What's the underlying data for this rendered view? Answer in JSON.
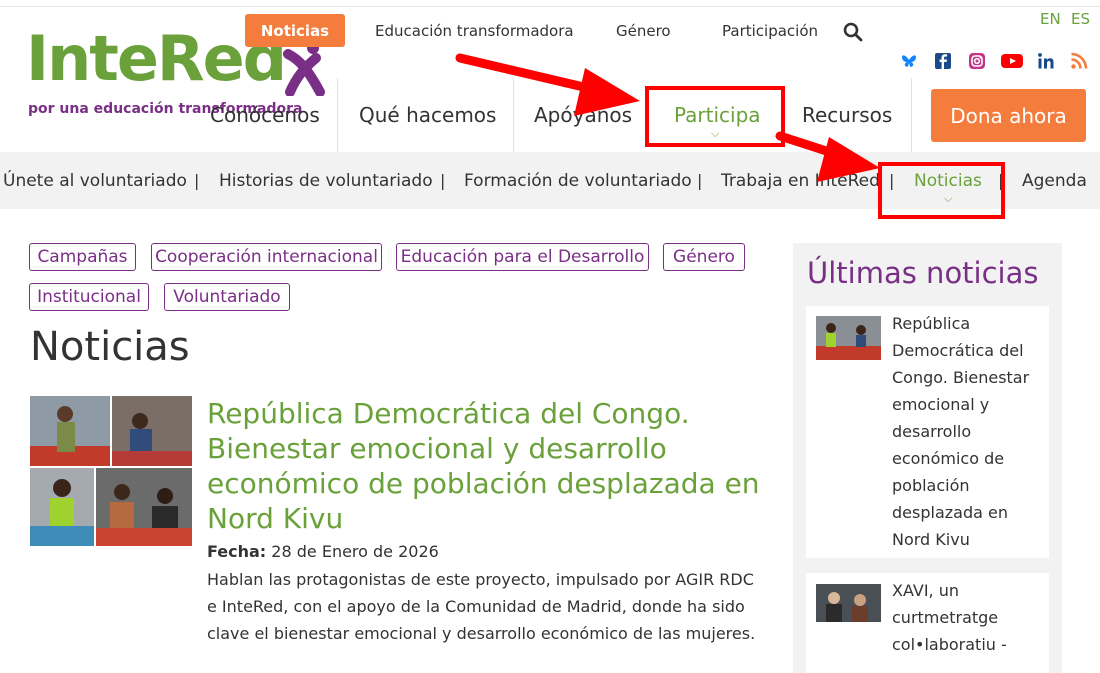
{
  "top_nav": {
    "active": "Noticias",
    "items": [
      "Educación transformadora",
      "Género",
      "Participación"
    ]
  },
  "lang": {
    "en": "EN",
    "es": "ES"
  },
  "logo": {
    "text": "InteRed",
    "tagline": "por una educación transformadora"
  },
  "main_nav": {
    "items": [
      "Conócenos",
      "Qué hacemos",
      "Apóyanos",
      "Participa",
      "Recursos"
    ],
    "donate": "Dona ahora"
  },
  "sub_nav": {
    "items": [
      "Únete al voluntariado",
      "Historias de voluntariado",
      "Formación de voluntariado",
      "Trabaja en InteRed",
      "Noticias",
      "Agenda"
    ],
    "separator": "|"
  },
  "tags": [
    "Campañas",
    "Cooperación internacional",
    "Educación para el Desarrollo",
    "Género",
    "Institucional",
    "Voluntariado"
  ],
  "page_title": "Noticias",
  "article": {
    "title": "República Democrática del Congo. Bienestar emocional y desarrollo económico de población desplazada en Nord Kivu",
    "date_label": "Fecha:",
    "date_value": "28 de Enero de 2026",
    "excerpt": "Hablan las protagonistas de este proyecto, impulsado por AGIR RDC e InteRed, con el apoyo de la Comunidad de Madrid, donde ha sido clave el bienestar emocional y desarrollo económico de las mujeres."
  },
  "sidebar": {
    "title": "Últimas noticias",
    "items": [
      {
        "text": "República Democrática del Congo. Bienestar emocional y desarrollo económico de población desplazada en Nord Kivu"
      },
      {
        "text": "XAVI, un curtmetratge col•laboratiu -"
      }
    ]
  },
  "colors": {
    "green": "#6aa13b",
    "purple": "#7a2f86",
    "orange": "#f47c3c",
    "annotation": "#ff0000"
  }
}
